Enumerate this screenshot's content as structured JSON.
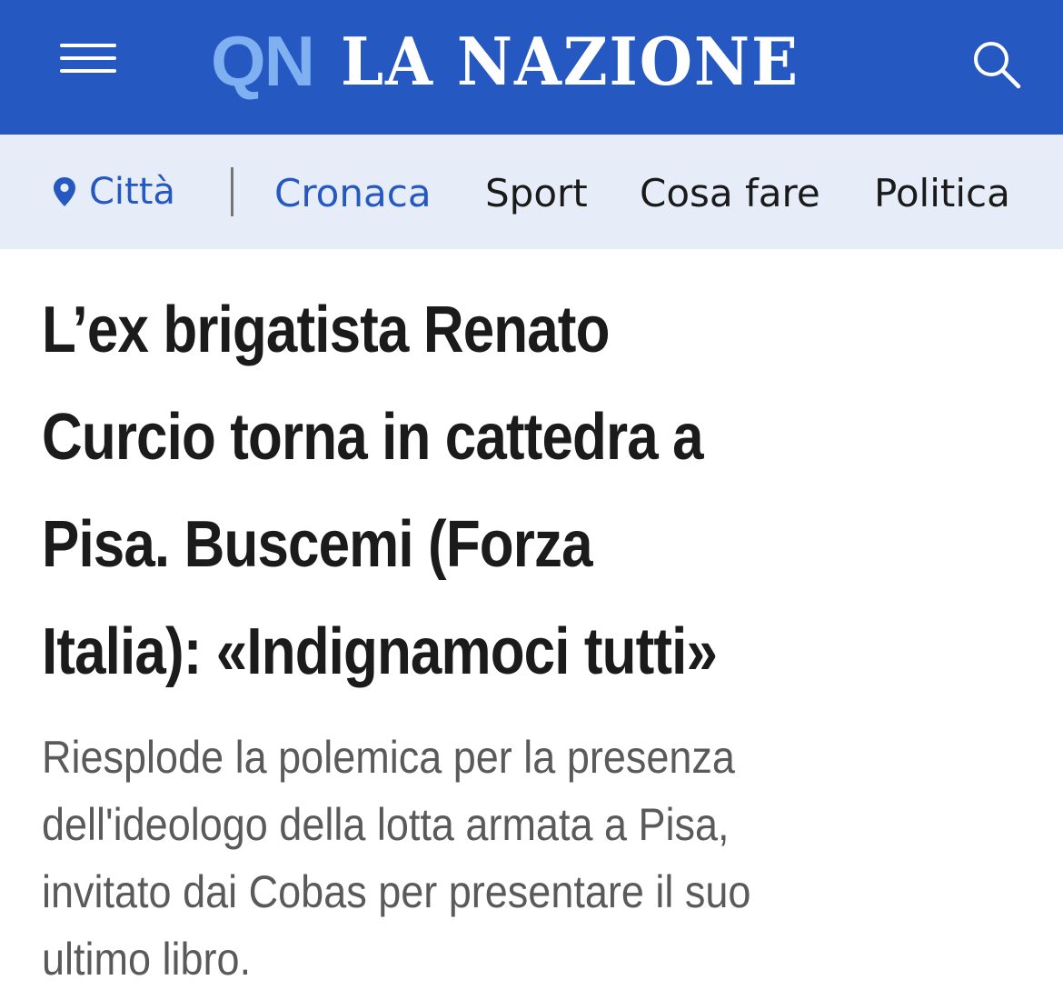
{
  "header": {
    "menu_icon": "hamburger-menu-icon",
    "logo_prefix": "QN",
    "logo_name": "LA NAZIONE",
    "search_icon": "search-icon",
    "colors": {
      "bar": "#2558c0",
      "logo_prefix": "#7fb0f2",
      "logo_name": "#ffffff"
    }
  },
  "subnav": {
    "city_icon": "location-pin-icon",
    "city_label": "Città",
    "items": [
      "Cronaca",
      "Sport",
      "Cosa fare",
      "Politica"
    ],
    "active_item": "Cronaca",
    "colors": {
      "background": "#e6edf8",
      "active": "#2558c0"
    }
  },
  "article": {
    "headline_lines": [
      "L’ex brigatista Renato",
      "Curcio torna in cattedra a",
      "Pisa. Buscemi (Forza",
      "Italia): «Indignamoci tutti»"
    ],
    "summary_lines": [
      "Riesplode la polemica per la presenza",
      "dell'ideologo della lotta armata a Pisa,",
      "invitato dai Cobas per presentare il suo",
      "ultimo libro."
    ]
  }
}
